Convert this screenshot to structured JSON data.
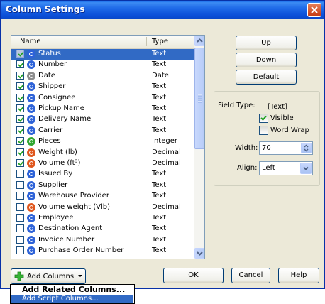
{
  "window": {
    "title": "Column Settings"
  },
  "list": {
    "headers": {
      "name": "Name",
      "type": "Type"
    },
    "rows": [
      {
        "name": "Status",
        "type": "Text",
        "checked": true,
        "icon": "blue-circle-icon",
        "color": "#2d62d8",
        "selected": true
      },
      {
        "name": "Number",
        "type": "Text",
        "checked": true,
        "icon": "blue-circle-icon",
        "color": "#2d62d8"
      },
      {
        "name": "Date",
        "type": "Date",
        "checked": true,
        "icon": "gray-circle-icon",
        "color": "#8c8c8c"
      },
      {
        "name": "Shipper",
        "type": "Text",
        "checked": true,
        "icon": "blue-circle-icon",
        "color": "#2d62d8"
      },
      {
        "name": "Consignee",
        "type": "Text",
        "checked": true,
        "icon": "blue-circle-icon",
        "color": "#2d62d8"
      },
      {
        "name": "Pickup Name",
        "type": "Text",
        "checked": true,
        "icon": "blue-circle-icon",
        "color": "#2d62d8"
      },
      {
        "name": "Delivery Name",
        "type": "Text",
        "checked": true,
        "icon": "blue-circle-icon",
        "color": "#2d62d8"
      },
      {
        "name": "Carrier",
        "type": "Text",
        "checked": true,
        "icon": "blue-circle-icon",
        "color": "#2d62d8"
      },
      {
        "name": "Pieces",
        "type": "Integer",
        "checked": true,
        "icon": "green-circle-icon",
        "color": "#2fa62f"
      },
      {
        "name": "Weight (lb)",
        "type": "Decimal",
        "checked": true,
        "icon": "orange-circle-icon",
        "color": "#e0561c"
      },
      {
        "name": "Volume (ft³)",
        "type": "Decimal",
        "checked": true,
        "icon": "orange-circle-icon",
        "color": "#e0561c"
      },
      {
        "name": "Issued By",
        "type": "Text",
        "checked": false,
        "icon": "blue-circle-icon",
        "color": "#2d62d8"
      },
      {
        "name": "Supplier",
        "type": "Text",
        "checked": false,
        "icon": "blue-circle-icon",
        "color": "#2d62d8"
      },
      {
        "name": "Warehouse Provider",
        "type": "Text",
        "checked": false,
        "icon": "blue-circle-icon",
        "color": "#2d62d8"
      },
      {
        "name": "Volume weight (Vlb)",
        "type": "Decimal",
        "checked": false,
        "icon": "orange-circle-icon",
        "color": "#e0561c"
      },
      {
        "name": "Employee",
        "type": "Text",
        "checked": false,
        "icon": "blue-circle-icon",
        "color": "#2d62d8"
      },
      {
        "name": "Destination Agent",
        "type": "Text",
        "checked": false,
        "icon": "blue-circle-icon",
        "color": "#2d62d8"
      },
      {
        "name": "Invoice Number",
        "type": "Text",
        "checked": false,
        "icon": "blue-circle-icon",
        "color": "#2d62d8"
      },
      {
        "name": "Purchase Order Number",
        "type": "Text",
        "checked": false,
        "icon": "blue-circle-icon",
        "color": "#2d62d8"
      }
    ]
  },
  "buttons": {
    "up": "Up",
    "down": "Down",
    "default": "Default",
    "ok": "OK",
    "cancel": "Cancel",
    "help": "Help",
    "add_columns": "Add Columns"
  },
  "properties": {
    "field_type_label": "Field Type:",
    "field_type_value": "[Text]",
    "visible_label": "Visible",
    "visible_checked": true,
    "word_wrap_label": "Word Wrap",
    "word_wrap_checked": false,
    "width_label": "Width:",
    "width_value": "70",
    "align_label": "Align:",
    "align_value": "Left"
  },
  "menu": {
    "add_related": "Add Related Columns...",
    "add_script": "Add Script Columns..."
  },
  "colors": {
    "accent": "#316ac5",
    "titlebar": "#0b4fd8"
  }
}
